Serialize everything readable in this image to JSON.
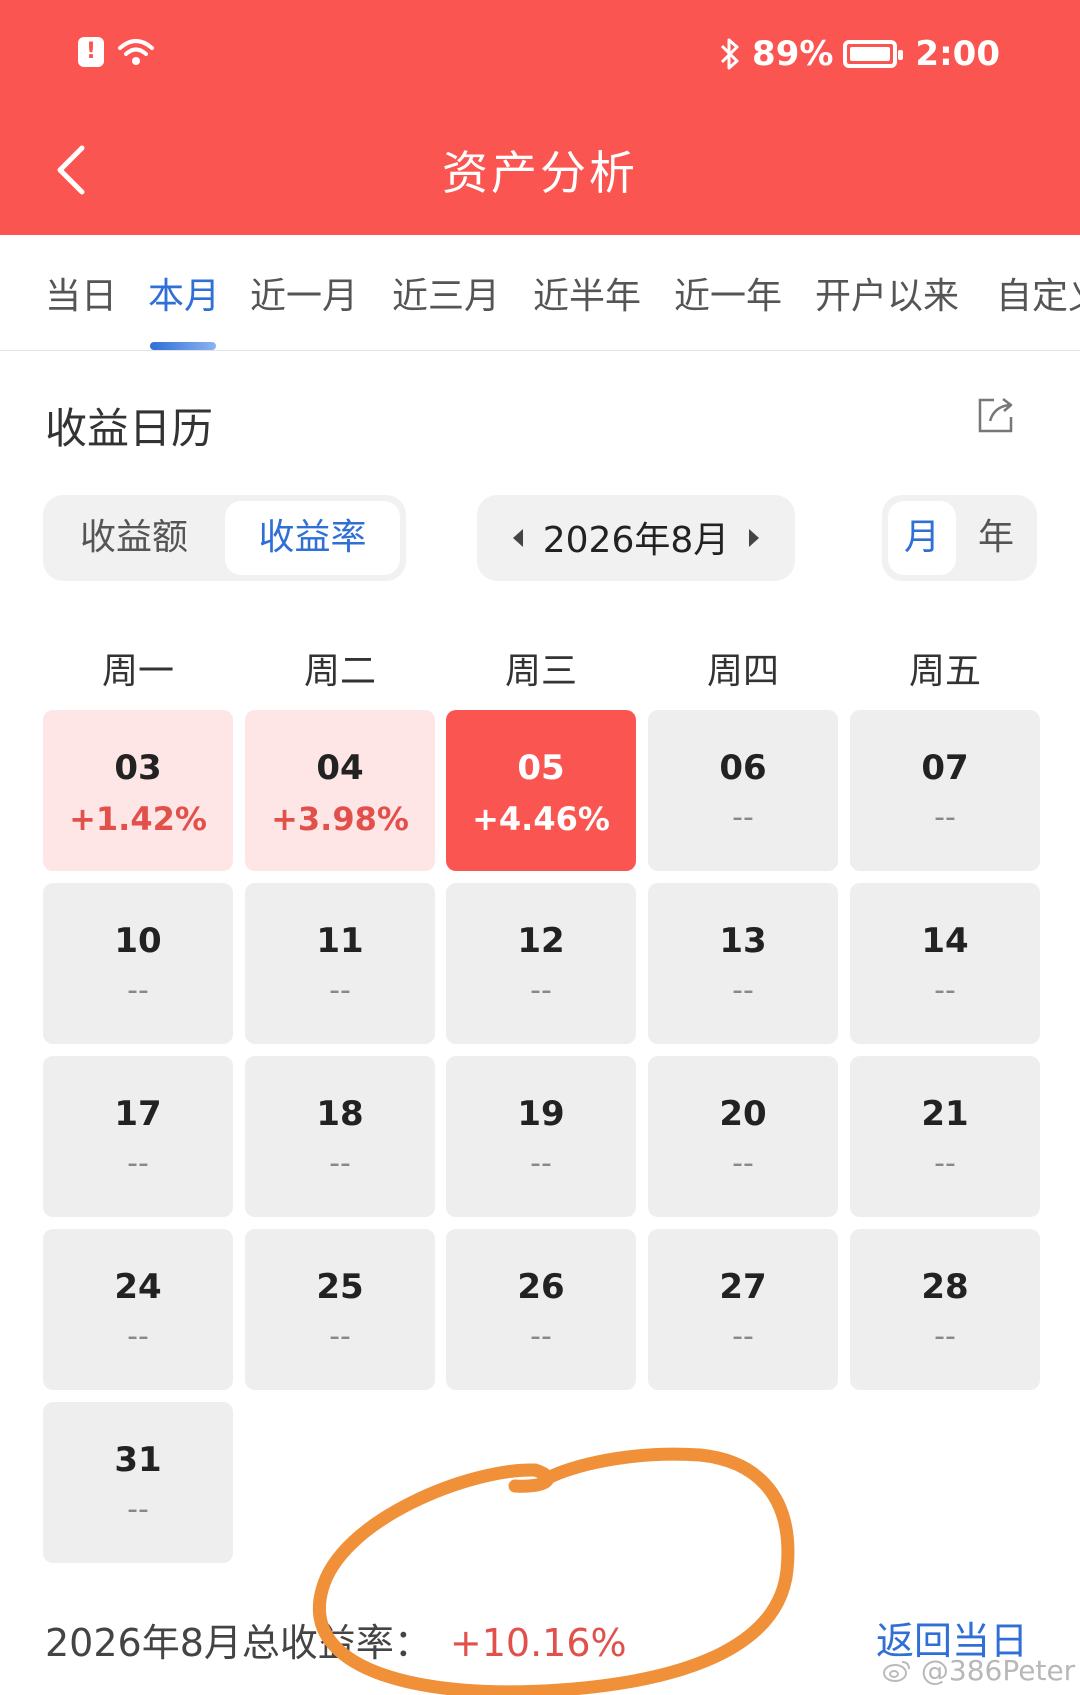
{
  "status_bar": {
    "alert_glyph": "!",
    "battery": "89%",
    "time": "2:00",
    "icons": [
      "alert-icon",
      "wifi-icon",
      "bluetooth-icon",
      "battery-icon"
    ]
  },
  "header": {
    "title": "资产分析",
    "back_icon": "chevron-left-icon"
  },
  "tabs": [
    {
      "label": "当日"
    },
    {
      "label": "本月",
      "active": true
    },
    {
      "label": "近一月"
    },
    {
      "label": "近三月"
    },
    {
      "label": "近半年"
    },
    {
      "label": "近一年"
    },
    {
      "label": "开户以来"
    },
    {
      "label": "自定义"
    }
  ],
  "section": {
    "title": "收益日历",
    "share_icon": "share-icon"
  },
  "controls": {
    "metric": {
      "options": [
        "收益额",
        "收益率"
      ],
      "selected": "收益率"
    },
    "month_label": "2026年8月",
    "period": {
      "options": [
        "月",
        "年"
      ],
      "selected": "月"
    }
  },
  "calendar": {
    "weekdays": [
      "周一",
      "周二",
      "周三",
      "周四",
      "周五"
    ],
    "weeks": [
      [
        {
          "day": "03",
          "value": "+1.42%"
        },
        {
          "day": "04",
          "value": "+3.98%"
        },
        {
          "day": "05",
          "value": "+4.46%"
        },
        {
          "day": "06",
          "value": "--"
        },
        {
          "day": "07",
          "value": "--"
        }
      ],
      [
        {
          "day": "10",
          "value": "--"
        },
        {
          "day": "11",
          "value": "--"
        },
        {
          "day": "12",
          "value": "--"
        },
        {
          "day": "13",
          "value": "--"
        },
        {
          "day": "14",
          "value": "--"
        }
      ],
      [
        {
          "day": "17",
          "value": "--"
        },
        {
          "day": "18",
          "value": "--"
        },
        {
          "day": "19",
          "value": "--"
        },
        {
          "day": "20",
          "value": "--"
        },
        {
          "day": "21",
          "value": "--"
        }
      ],
      [
        {
          "day": "24",
          "value": "--"
        },
        {
          "day": "25",
          "value": "--"
        },
        {
          "day": "26",
          "value": "--"
        },
        {
          "day": "27",
          "value": "--"
        },
        {
          "day": "28",
          "value": "--"
        }
      ],
      [
        {
          "day": "31",
          "value": "--"
        }
      ]
    ]
  },
  "footer": {
    "total_label": "2026年8月总收益率：",
    "total_value": "+10.16%",
    "return_label": "返回当日",
    "watermark": "@386Peter"
  },
  "colors": {
    "brand_red": "#fb5551",
    "accent_blue": "#2f6fd6",
    "gain_red": "#e2504c",
    "annotation_orange": "#f0913a"
  }
}
